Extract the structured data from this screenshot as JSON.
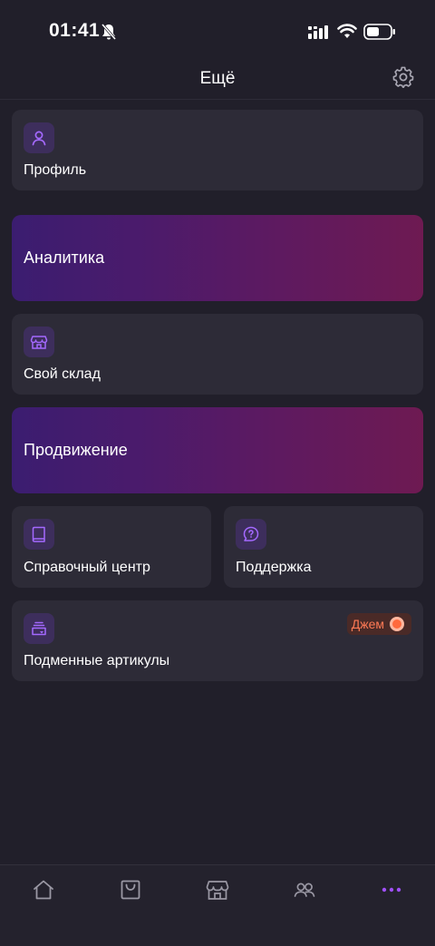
{
  "status_bar": {
    "time": "01:41"
  },
  "header": {
    "title": "Ещё"
  },
  "cards": {
    "profile": {
      "label": "Профиль",
      "icon": "user-icon"
    },
    "analytics": {
      "label": "Аналитика"
    },
    "warehouse": {
      "label": "Свой склад",
      "icon": "store-icon"
    },
    "promotion": {
      "label": "Продвижение"
    },
    "help_center": {
      "label": "Справочный центр",
      "icon": "book-icon"
    },
    "support": {
      "label": "Поддержка",
      "icon": "help-chat-icon"
    },
    "substitute": {
      "label": "Подменные артикулы",
      "icon": "stack-icon",
      "badge": "Джем"
    }
  },
  "nav": [
    "home-icon",
    "bag-icon",
    "store-icon",
    "users-icon",
    "more-icon"
  ],
  "colors": {
    "background": "#211f2a",
    "card": "#2d2b37",
    "accent": "#9b5cff",
    "badge": "#ff7a55"
  }
}
